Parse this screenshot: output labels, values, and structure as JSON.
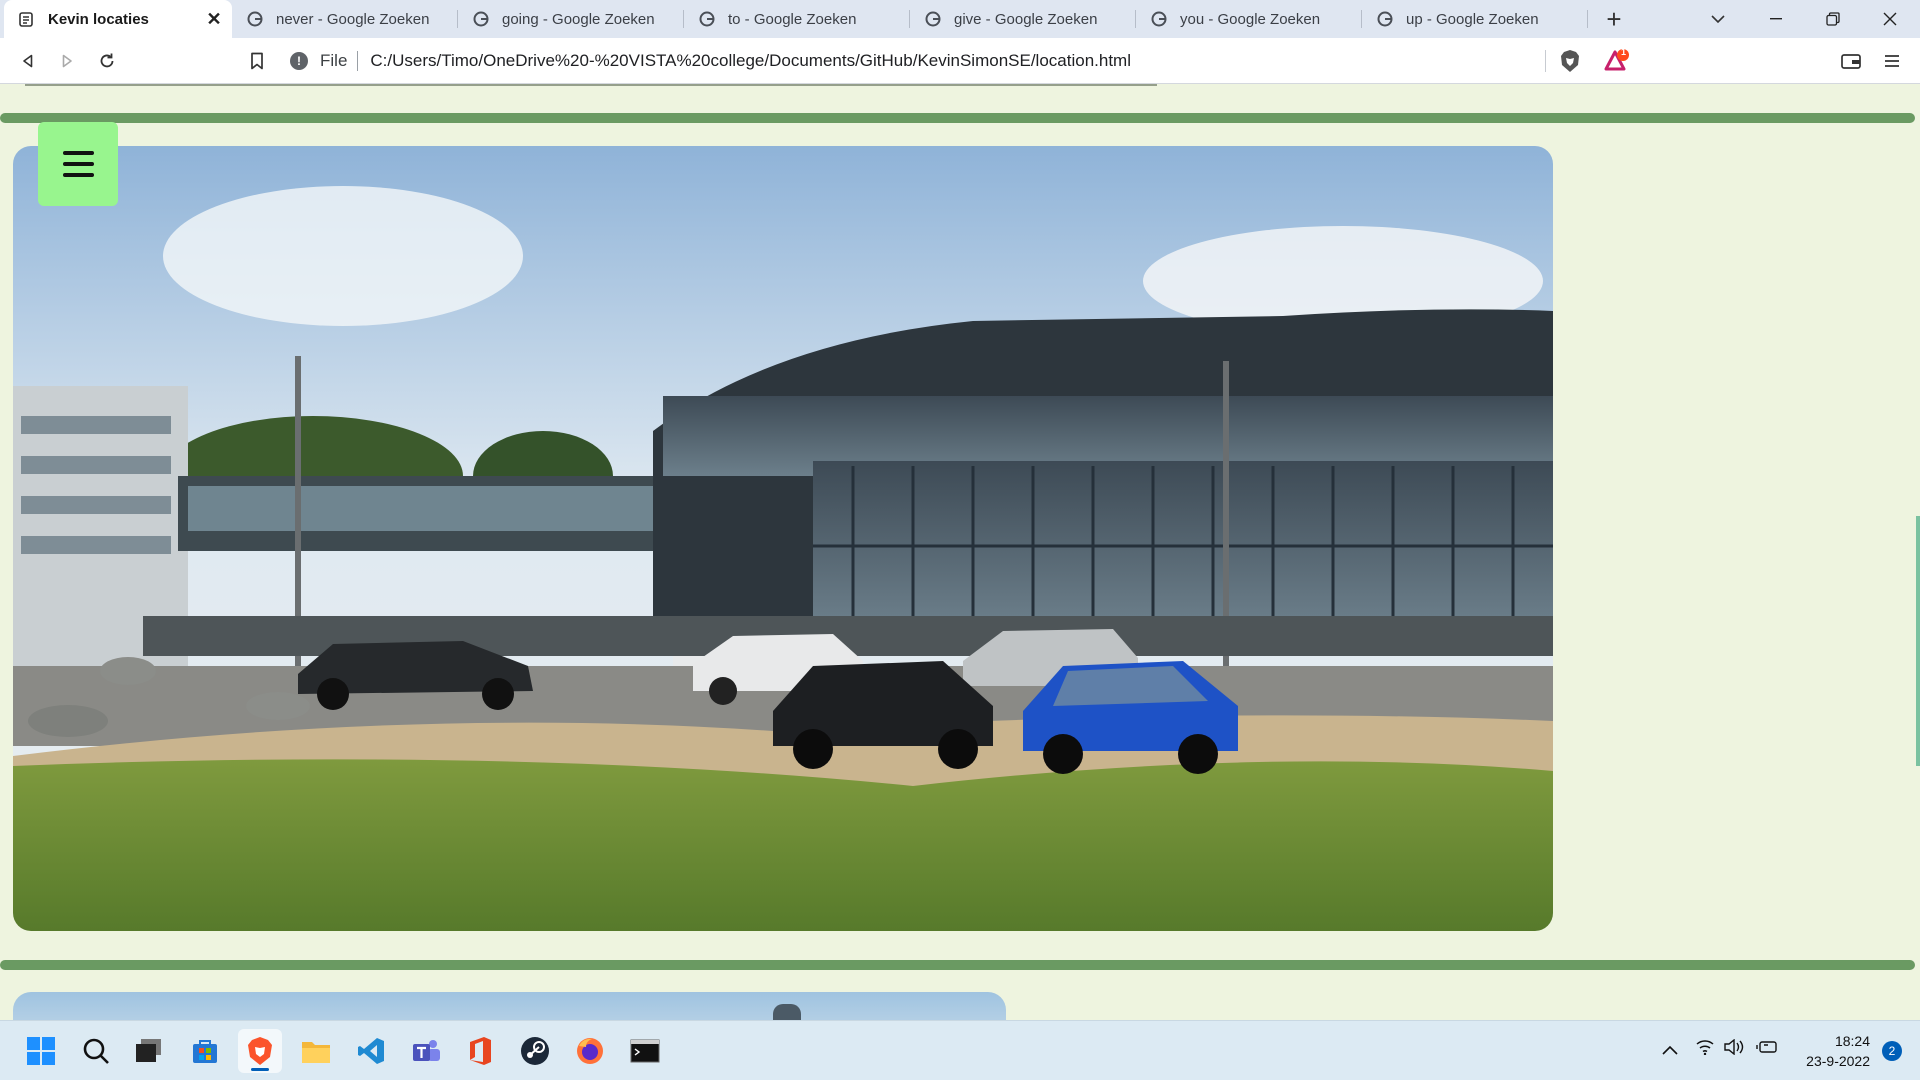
{
  "browser": {
    "tabs": [
      {
        "title": "Kevin locaties",
        "active": true,
        "icon": "page-icon"
      },
      {
        "title": "never - Google Zoeken",
        "active": false,
        "icon": "google-icon"
      },
      {
        "title": "going - Google Zoeken",
        "active": false,
        "icon": "google-icon"
      },
      {
        "title": "to - Google Zoeken",
        "active": false,
        "icon": "google-icon"
      },
      {
        "title": "give - Google Zoeken",
        "active": false,
        "icon": "google-icon"
      },
      {
        "title": "you - Google Zoeken",
        "active": false,
        "icon": "google-icon"
      },
      {
        "title": "up - Google Zoeken",
        "active": false,
        "icon": "google-icon"
      }
    ],
    "address": {
      "scheme_label": "File",
      "url": "C:/Users/Timo/OneDrive%20-%20VISTA%20college/Documents/GitHub/KevinSimonSE/location.html"
    },
    "brave_rewards_count": "1",
    "accent_color": "#6a9a62"
  },
  "page": {
    "menu_button_color": "#98f58e",
    "hero_image": "photo of a modern glass college building with parked cars and grass"
  },
  "taskbar": {
    "apps": [
      "start",
      "search",
      "task-view",
      "store",
      "brave",
      "file-explorer",
      "vscode",
      "teams",
      "office",
      "steam",
      "firefox",
      "terminal"
    ],
    "time": "18:24",
    "date": "23-9-2022",
    "notifications": "2"
  }
}
